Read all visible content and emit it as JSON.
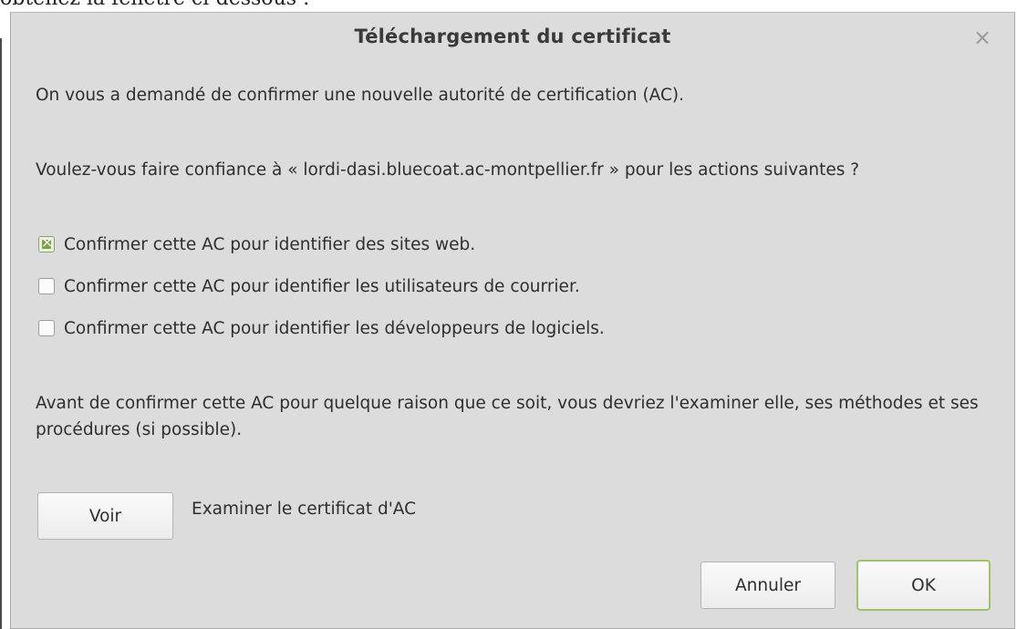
{
  "background": {
    "caption": "obtenez la fenêtre ci-dessous :"
  },
  "dialog": {
    "title": "Téléchargement du certificat",
    "close_icon": "×",
    "intro": "On vous a demandé de confirmer une nouvelle autorité de certification (AC).",
    "question": "Voulez-vous faire confiance à « lordi-dasi.bluecoat.ac-montpellier.fr » pour les actions suivantes ?",
    "options": [
      {
        "label": "Confirmer cette AC pour identifier des sites web.",
        "checked": true
      },
      {
        "label": "Confirmer cette AC pour identifier les utilisateurs de courrier.",
        "checked": false
      },
      {
        "label": "Confirmer cette AC pour identifier les développeurs de logiciels.",
        "checked": false
      }
    ],
    "warning": "Avant de confirmer cette AC pour quelque raison que ce soit, vous devriez l'examiner elle, ses méthodes et ses procédures (si possible).",
    "view_button": "Voir",
    "view_description": "Examiner le certificat d'AC",
    "cancel_button": "Annuler",
    "ok_button": "OK"
  },
  "colors": {
    "dialog_bg": "#dcdcdc",
    "accent_green": "#9dc46b",
    "checkbox_checked": "#7aa24a"
  }
}
